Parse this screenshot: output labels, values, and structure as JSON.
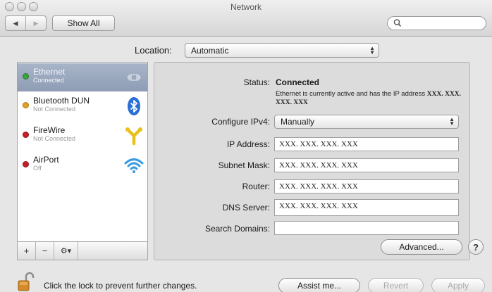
{
  "window": {
    "title": "Network"
  },
  "toolbar": {
    "back_icon": "back-arrow-icon",
    "forward_icon": "forward-arrow-icon",
    "show_all_label": "Show All",
    "search_value": ""
  },
  "location": {
    "label": "Location:",
    "value": "Automatic"
  },
  "services": [
    {
      "name": "Ethernet",
      "status": "Connected",
      "dot_color": "#3aa53a",
      "icon": "ethernet-icon",
      "selected": true
    },
    {
      "name": "Bluetooth DUN",
      "status": "Not Connected",
      "dot_color": "#e0a020",
      "icon": "bluetooth-icon",
      "selected": false
    },
    {
      "name": "FireWire",
      "status": "Not Connected",
      "dot_color": "#c8202a",
      "icon": "firewire-icon",
      "selected": false
    },
    {
      "name": "AirPort",
      "status": "Off",
      "dot_color": "#c8202a",
      "icon": "wifi-icon",
      "selected": false
    }
  ],
  "list_controls": {
    "add": "+",
    "remove": "−",
    "gear": "⚙▾"
  },
  "detail": {
    "status_label": "Status:",
    "status_value": "Connected",
    "status_desc_prefix": "Ethernet is currently active and has the IP address",
    "status_desc_ip": "XXX. XXX. XXX. XXX",
    "configure_label": "Configure IPv4:",
    "configure_value": "Manually",
    "ip_label": "IP Address:",
    "ip_value": "XXX. XXX. XXX. XXX",
    "subnet_label": "Subnet Mask:",
    "subnet_value": "XXX. XXX. XXX. XXX",
    "router_label": "Router:",
    "router_value": "XXX. XXX. XXX. XXX",
    "dns_label": "DNS Server:",
    "dns_value": "XXX. XXX. XXX. XXX",
    "search_domains_label": "Search Domains:",
    "search_domains_value": "",
    "advanced_label": "Advanced...",
    "help_label": "?"
  },
  "footer": {
    "lock_text": "Click the lock to prevent further changes.",
    "assist_label": "Assist me...",
    "revert_label": "Revert",
    "apply_label": "Apply"
  },
  "colors": {
    "selection": "#97a5bc",
    "bluetooth": "#2a6fd6",
    "firewire": "#e8c11a",
    "airport": "#3a9be0"
  }
}
